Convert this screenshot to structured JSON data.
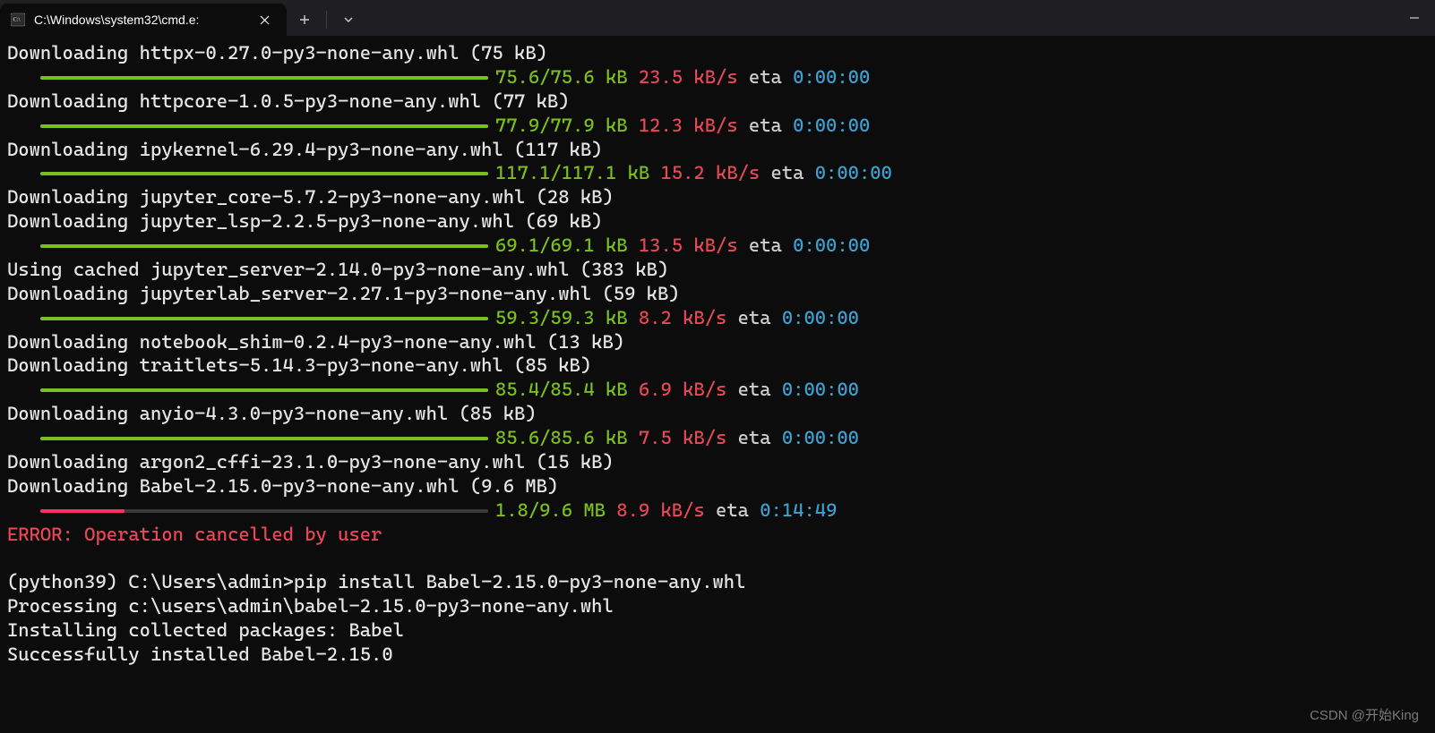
{
  "titlebar": {
    "tab_title": "C:\\Windows\\system32\\cmd.e:",
    "tab_icon": "cmd-icon"
  },
  "colors": {
    "green": "#7bbf1e",
    "red": "#e74856",
    "cyan": "#3da0d0",
    "pink": "#ff2f66"
  },
  "lines": [
    {
      "type": "text",
      "text": "Downloading httpx-0.27.0-py3-none-any.whl (75 kB)"
    },
    {
      "type": "progress",
      "pct": 100,
      "size": "75.6/75.6 kB",
      "speed": "23.5 kB/s",
      "eta_label": "eta",
      "eta": "0:00:00"
    },
    {
      "type": "text",
      "text": "Downloading httpcore-1.0.5-py3-none-any.whl (77 kB)"
    },
    {
      "type": "progress",
      "pct": 100,
      "size": "77.9/77.9 kB",
      "speed": "12.3 kB/s",
      "eta_label": "eta",
      "eta": "0:00:00"
    },
    {
      "type": "text",
      "text": "Downloading ipykernel-6.29.4-py3-none-any.whl (117 kB)"
    },
    {
      "type": "progress",
      "pct": 100,
      "size": "117.1/117.1 kB",
      "speed": "15.2 kB/s",
      "eta_label": "eta",
      "eta": "0:00:00"
    },
    {
      "type": "text",
      "text": "Downloading jupyter_core-5.7.2-py3-none-any.whl (28 kB)"
    },
    {
      "type": "text",
      "text": "Downloading jupyter_lsp-2.2.5-py3-none-any.whl (69 kB)"
    },
    {
      "type": "progress",
      "pct": 100,
      "size": "69.1/69.1 kB",
      "speed": "13.5 kB/s",
      "eta_label": "eta",
      "eta": "0:00:00"
    },
    {
      "type": "text",
      "text": "Using cached jupyter_server-2.14.0-py3-none-any.whl (383 kB)"
    },
    {
      "type": "text",
      "text": "Downloading jupyterlab_server-2.27.1-py3-none-any.whl (59 kB)"
    },
    {
      "type": "progress",
      "pct": 100,
      "size": "59.3/59.3 kB",
      "speed": "8.2 kB/s",
      "eta_label": "eta",
      "eta": "0:00:00"
    },
    {
      "type": "text",
      "text": "Downloading notebook_shim-0.2.4-py3-none-any.whl (13 kB)"
    },
    {
      "type": "text",
      "text": "Downloading traitlets-5.14.3-py3-none-any.whl (85 kB)"
    },
    {
      "type": "progress",
      "pct": 100,
      "size": "85.4/85.4 kB",
      "speed": "6.9 kB/s",
      "eta_label": "eta",
      "eta": "0:00:00"
    },
    {
      "type": "text",
      "text": "Downloading anyio-4.3.0-py3-none-any.whl (85 kB)"
    },
    {
      "type": "progress",
      "pct": 100,
      "size": "85.6/85.6 kB",
      "speed": "7.5 kB/s",
      "eta_label": "eta",
      "eta": "0:00:00"
    },
    {
      "type": "text",
      "text": "Downloading argon2_cffi-23.1.0-py3-none-any.whl (15 kB)"
    },
    {
      "type": "text",
      "text": "Downloading Babel-2.15.0-py3-none-any.whl (9.6 MB)"
    },
    {
      "type": "progress",
      "pct": 18.75,
      "partial": true,
      "size": "1.8/9.6 MB",
      "speed": "8.9 kB/s",
      "eta_label": "eta",
      "eta": "0:14:49"
    },
    {
      "type": "error",
      "text": "ERROR: Operation cancelled by user"
    },
    {
      "type": "blank"
    },
    {
      "type": "text",
      "text": "(python39) C:\\Users\\admin>pip install Babel-2.15.0-py3-none-any.whl"
    },
    {
      "type": "text",
      "text": "Processing c:\\users\\admin\\babel-2.15.0-py3-none-any.whl"
    },
    {
      "type": "text",
      "text": "Installing collected packages: Babel"
    },
    {
      "type": "text",
      "text": "Successfully installed Babel-2.15.0"
    }
  ],
  "watermark": "CSDN @开始King"
}
